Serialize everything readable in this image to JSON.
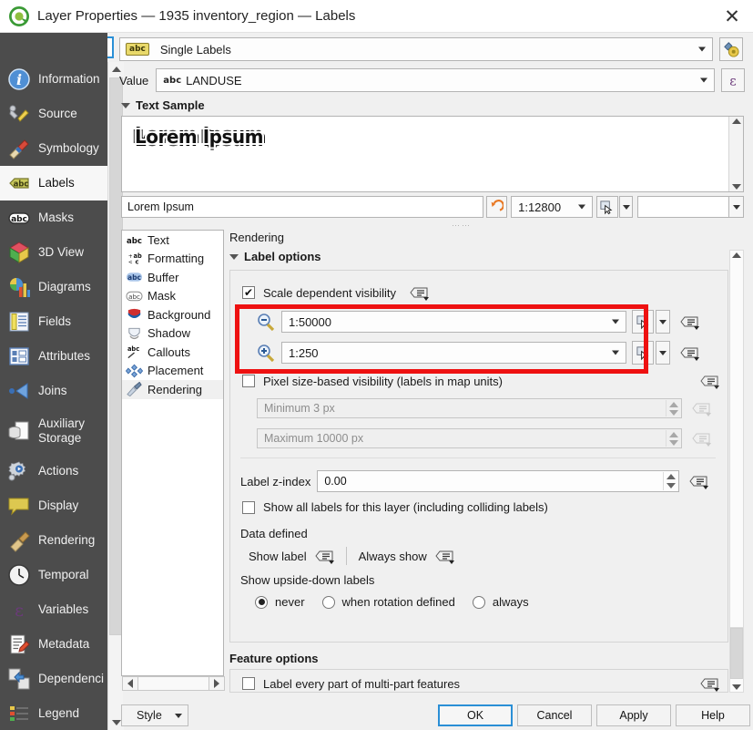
{
  "window": {
    "title": "Layer Properties — 1935 inventory_region — Labels",
    "close_label": "✕",
    "logo_icon": "qgis-logo"
  },
  "search": {
    "value": "",
    "placeholder": "",
    "icon": "search-icon"
  },
  "sidebar": {
    "items": [
      {
        "label": "Information",
        "icon": "info-icon",
        "selected": false
      },
      {
        "label": "Source",
        "icon": "source-icon",
        "selected": false
      },
      {
        "label": "Symbology",
        "icon": "symbology-icon",
        "selected": false
      },
      {
        "label": "Labels",
        "icon": "labels-icon",
        "selected": true
      },
      {
        "label": "Masks",
        "icon": "masks-icon",
        "selected": false
      },
      {
        "label": "3D View",
        "icon": "cube-icon",
        "selected": false
      },
      {
        "label": "Diagrams",
        "icon": "diagrams-icon",
        "selected": false
      },
      {
        "label": "Fields",
        "icon": "fields-icon",
        "selected": false
      },
      {
        "label": "Attributes",
        "icon": "attributes-icon",
        "selected": false
      },
      {
        "label": "Joins",
        "icon": "joins-icon",
        "selected": false
      },
      {
        "label": "Auxiliary Storage",
        "icon": "auxiliary-storage-icon",
        "selected": false
      },
      {
        "label": "Actions",
        "icon": "actions-icon",
        "selected": false
      },
      {
        "label": "Display",
        "icon": "display-icon",
        "selected": false
      },
      {
        "label": "Rendering",
        "icon": "rendering-icon",
        "selected": false
      },
      {
        "label": "Temporal",
        "icon": "temporal-icon",
        "selected": false
      },
      {
        "label": "Variables",
        "icon": "variables-icon",
        "selected": false
      },
      {
        "label": "Metadata",
        "icon": "metadata-icon",
        "selected": false
      },
      {
        "label": "Dependenci",
        "icon": "dependencies-icon",
        "selected": false
      },
      {
        "label": "Legend",
        "icon": "legend-icon",
        "selected": false
      }
    ]
  },
  "labeling": {
    "mode": "Single Labels",
    "mode_icon": "abc-label-icon",
    "style_button_icon": "style-manager-icon",
    "value_label": "Value",
    "value_field": "LANDUSE",
    "value_field_type": "abc",
    "expression_button_icon": "epsilon-expression-icon"
  },
  "text_sample": {
    "section_title": "Text Sample",
    "preview_text": "Lorem Ipsum",
    "input_value": "Lorem Ipsum",
    "revert_icon": "revert-arrow-icon",
    "scale": "1:12800",
    "map_pick_icon": "map-pick-icon",
    "color_value": ""
  },
  "tabs": [
    {
      "label": "Text",
      "icon": "abc-text-icon",
      "selected": false
    },
    {
      "label": "Formatting",
      "icon": "formatting-icon",
      "selected": false
    },
    {
      "label": "Buffer",
      "icon": "buffer-icon",
      "selected": false
    },
    {
      "label": "Mask",
      "icon": "mask-icon",
      "selected": false
    },
    {
      "label": "Background",
      "icon": "background-icon",
      "selected": false
    },
    {
      "label": "Shadow",
      "icon": "shadow-icon",
      "selected": false
    },
    {
      "label": "Callouts",
      "icon": "callouts-icon",
      "selected": false
    },
    {
      "label": "Placement",
      "icon": "placement-icon",
      "selected": false
    },
    {
      "label": "Rendering",
      "icon": "rendering-brush-icon",
      "selected": true
    }
  ],
  "pane": {
    "title": "Rendering",
    "label_options": {
      "section_title": "Label options",
      "scale_dependent": {
        "label": "Scale dependent visibility",
        "checked": true,
        "data_defined_icon": "data-defined-icon"
      },
      "min_scale": {
        "value": "1:50000",
        "icon": "zoom-out-icon",
        "pick_icon": "map-pick-icon",
        "data_defined_icon": "data-defined-icon"
      },
      "max_scale": {
        "value": "1:250",
        "icon": "zoom-in-icon",
        "pick_icon": "map-pick-icon",
        "data_defined_icon": "data-defined-icon"
      },
      "pixel_size": {
        "label": "Pixel size-based visibility (labels in map units)",
        "checked": false,
        "minimum_placeholder": "Minimum 3 px",
        "maximum_placeholder": "Maximum 10000 px",
        "data_defined_icon": "data-defined-icon"
      },
      "z_index": {
        "label": "Label z-index",
        "value": "0.00",
        "data_defined_icon": "data-defined-icon"
      },
      "show_all_labels": {
        "label": "Show all labels for this layer (including colliding labels)",
        "checked": false
      },
      "data_defined": {
        "label": "Data defined",
        "show_label": "Show label",
        "always_show": "Always show",
        "data_defined_icon": "data-defined-icon"
      },
      "upside_down": {
        "label": "Show upside-down labels",
        "options": [
          {
            "label": "never",
            "selected": true
          },
          {
            "label": "when rotation defined",
            "selected": false
          },
          {
            "label": "always",
            "selected": false
          }
        ]
      }
    },
    "feature_options": {
      "section_title": "Feature options",
      "multi_part": {
        "label": "Label every part of multi-part features",
        "checked": false,
        "data_defined_icon": "data-defined-icon"
      }
    }
  },
  "footer": {
    "style_label": "Style",
    "ok_label": "OK",
    "cancel_label": "Cancel",
    "apply_label": "Apply",
    "help_label": "Help"
  },
  "colors": {
    "sidebar_bg": "#4c4c4c",
    "dialog_bg": "#f0f0f0",
    "annotation_red": "#ee1111",
    "focus_blue": "#2a8fd6",
    "accent_orange": "#e87722"
  }
}
